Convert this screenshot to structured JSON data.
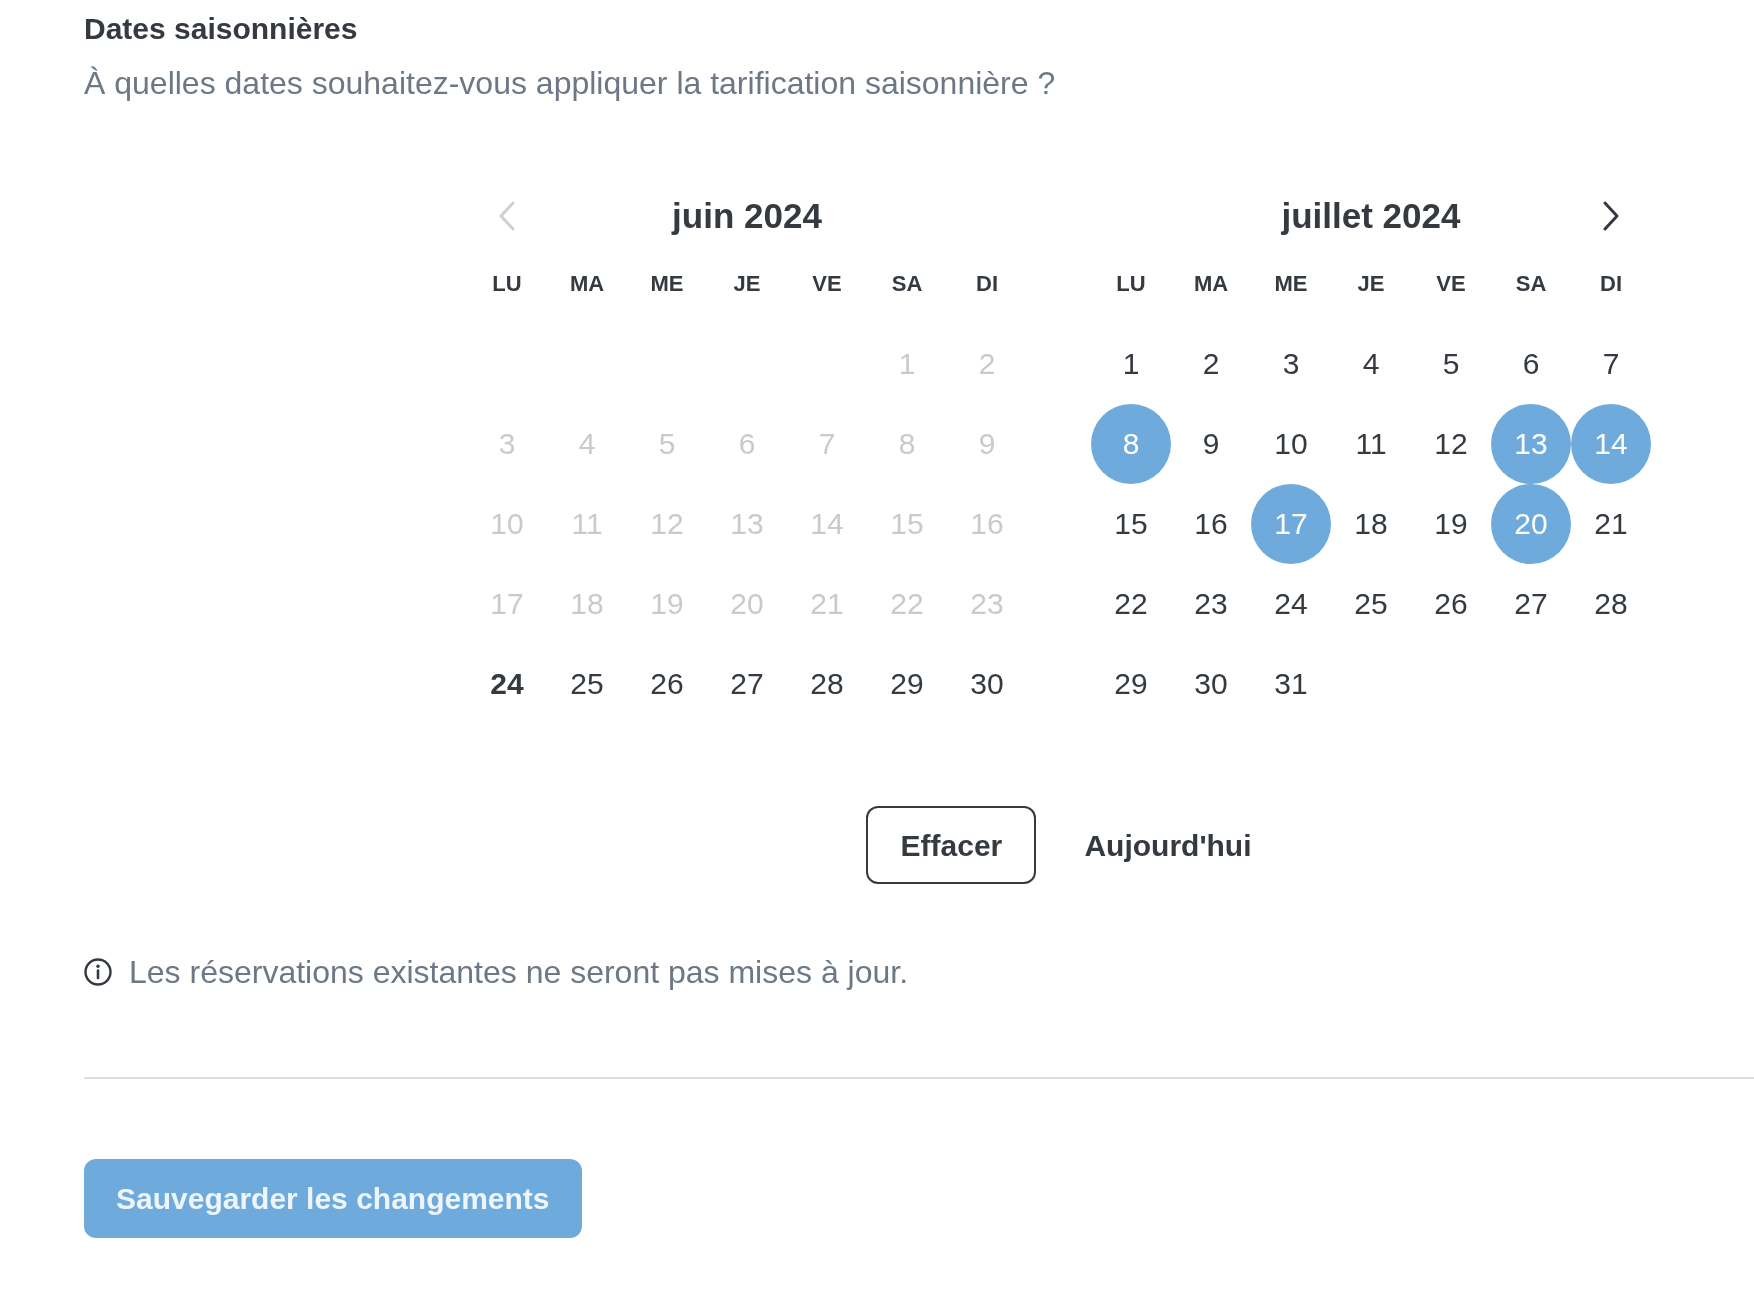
{
  "header": {
    "title": "Dates saisonnières",
    "subtitle": "À quelles dates souhaitez-vous appliquer la tarification saisonnière ?"
  },
  "calendar": {
    "navigation": {
      "previous": {
        "disabled": true
      },
      "next": {
        "disabled": false
      }
    },
    "months": [
      {
        "title": "juin 2024",
        "weekdays": [
          "LU",
          "MA",
          "ME",
          "JE",
          "VE",
          "SA",
          "DI"
        ],
        "weeks": [
          {
            "align_end": true,
            "days": [
              {
                "label": "1",
                "disabled": true,
                "selected": false,
                "today": false
              },
              {
                "label": "2",
                "disabled": true,
                "selected": false,
                "today": false
              }
            ]
          },
          {
            "days": [
              {
                "label": "3",
                "disabled": true,
                "selected": false,
                "today": false
              },
              {
                "label": "4",
                "disabled": true,
                "selected": false,
                "today": false
              },
              {
                "label": "5",
                "disabled": true,
                "selected": false,
                "today": false
              },
              {
                "label": "6",
                "disabled": true,
                "selected": false,
                "today": false
              },
              {
                "label": "7",
                "disabled": true,
                "selected": false,
                "today": false
              },
              {
                "label": "8",
                "disabled": true,
                "selected": false,
                "today": false
              },
              {
                "label": "9",
                "disabled": true,
                "selected": false,
                "today": false
              }
            ]
          },
          {
            "days": [
              {
                "label": "10",
                "disabled": true,
                "selected": false,
                "today": false
              },
              {
                "label": "11",
                "disabled": true,
                "selected": false,
                "today": false
              },
              {
                "label": "12",
                "disabled": true,
                "selected": false,
                "today": false
              },
              {
                "label": "13",
                "disabled": true,
                "selected": false,
                "today": false
              },
              {
                "label": "14",
                "disabled": true,
                "selected": false,
                "today": false
              },
              {
                "label": "15",
                "disabled": true,
                "selected": false,
                "today": false
              },
              {
                "label": "16",
                "disabled": true,
                "selected": false,
                "today": false
              }
            ]
          },
          {
            "days": [
              {
                "label": "17",
                "disabled": true,
                "selected": false,
                "today": false
              },
              {
                "label": "18",
                "disabled": true,
                "selected": false,
                "today": false
              },
              {
                "label": "19",
                "disabled": true,
                "selected": false,
                "today": false
              },
              {
                "label": "20",
                "disabled": true,
                "selected": false,
                "today": false
              },
              {
                "label": "21",
                "disabled": true,
                "selected": false,
                "today": false
              },
              {
                "label": "22",
                "disabled": true,
                "selected": false,
                "today": false
              },
              {
                "label": "23",
                "disabled": true,
                "selected": false,
                "today": false
              }
            ]
          },
          {
            "days": [
              {
                "label": "24",
                "disabled": false,
                "selected": false,
                "today": true
              },
              {
                "label": "25",
                "disabled": false,
                "selected": false,
                "today": false
              },
              {
                "label": "26",
                "disabled": false,
                "selected": false,
                "today": false
              },
              {
                "label": "27",
                "disabled": false,
                "selected": false,
                "today": false
              },
              {
                "label": "28",
                "disabled": false,
                "selected": false,
                "today": false
              },
              {
                "label": "29",
                "disabled": false,
                "selected": false,
                "today": false
              },
              {
                "label": "30",
                "disabled": false,
                "selected": false,
                "today": false
              }
            ]
          }
        ]
      },
      {
        "title": "juillet 2024",
        "weekdays": [
          "LU",
          "MA",
          "ME",
          "JE",
          "VE",
          "SA",
          "DI"
        ],
        "weeks": [
          {
            "days": [
              {
                "label": "1",
                "disabled": false,
                "selected": false,
                "today": false
              },
              {
                "label": "2",
                "disabled": false,
                "selected": false,
                "today": false
              },
              {
                "label": "3",
                "disabled": false,
                "selected": false,
                "today": false
              },
              {
                "label": "4",
                "disabled": false,
                "selected": false,
                "today": false
              },
              {
                "label": "5",
                "disabled": false,
                "selected": false,
                "today": false
              },
              {
                "label": "6",
                "disabled": false,
                "selected": false,
                "today": false
              },
              {
                "label": "7",
                "disabled": false,
                "selected": false,
                "today": false
              }
            ]
          },
          {
            "days": [
              {
                "label": "8",
                "disabled": false,
                "selected": true,
                "today": false
              },
              {
                "label": "9",
                "disabled": false,
                "selected": false,
                "today": false
              },
              {
                "label": "10",
                "disabled": false,
                "selected": false,
                "today": false
              },
              {
                "label": "11",
                "disabled": false,
                "selected": false,
                "today": false
              },
              {
                "label": "12",
                "disabled": false,
                "selected": false,
                "today": false
              },
              {
                "label": "13",
                "disabled": false,
                "selected": true,
                "today": false
              },
              {
                "label": "14",
                "disabled": false,
                "selected": true,
                "today": false
              }
            ]
          },
          {
            "days": [
              {
                "label": "15",
                "disabled": false,
                "selected": false,
                "today": false
              },
              {
                "label": "16",
                "disabled": false,
                "selected": false,
                "today": false
              },
              {
                "label": "17",
                "disabled": false,
                "selected": true,
                "today": false
              },
              {
                "label": "18",
                "disabled": false,
                "selected": false,
                "today": false
              },
              {
                "label": "19",
                "disabled": false,
                "selected": false,
                "today": false
              },
              {
                "label": "20",
                "disabled": false,
                "selected": true,
                "today": false
              },
              {
                "label": "21",
                "disabled": false,
                "selected": false,
                "today": false
              }
            ]
          },
          {
            "days": [
              {
                "label": "22",
                "disabled": false,
                "selected": false,
                "today": false
              },
              {
                "label": "23",
                "disabled": false,
                "selected": false,
                "today": false
              },
              {
                "label": "24",
                "disabled": false,
                "selected": false,
                "today": false
              },
              {
                "label": "25",
                "disabled": false,
                "selected": false,
                "today": false
              },
              {
                "label": "26",
                "disabled": false,
                "selected": false,
                "today": false
              },
              {
                "label": "27",
                "disabled": false,
                "selected": false,
                "today": false
              },
              {
                "label": "28",
                "disabled": false,
                "selected": false,
                "today": false
              }
            ]
          },
          {
            "align_end": false,
            "days": [
              {
                "label": "29",
                "disabled": false,
                "selected": false,
                "today": false
              },
              {
                "label": "30",
                "disabled": false,
                "selected": false,
                "today": false
              },
              {
                "label": "31",
                "disabled": false,
                "selected": false,
                "today": false
              }
            ]
          }
        ]
      }
    ],
    "actions": [
      {
        "kind": "outlined",
        "label": "Effacer"
      },
      {
        "kind": "plain",
        "label": "Aujourd'hui"
      }
    ]
  },
  "notice": {
    "text": "Les réservations existantes ne seront pas mises à jour."
  },
  "save_button": {
    "label": "Sauvegarder les changements"
  }
}
